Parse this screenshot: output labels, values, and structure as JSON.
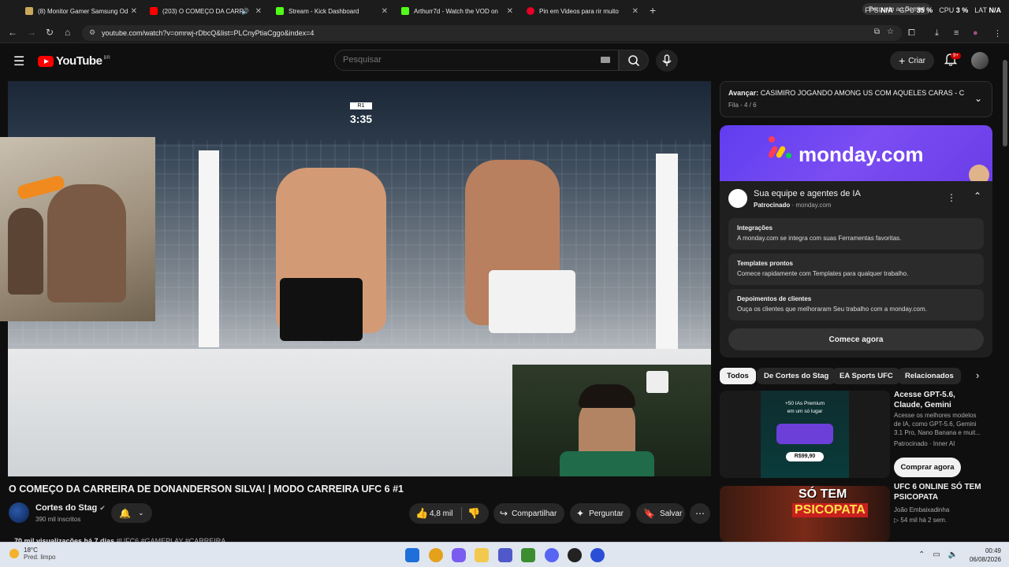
{
  "browser": {
    "tabs": [
      {
        "title": "(8) Monitor Gamer Samsung Od",
        "color": "#c9a85b"
      },
      {
        "title": "(203) O COMEÇO DA CARR",
        "color": "#ff0000"
      },
      {
        "title": "Stream - Kick Dashboard",
        "color": "#53fc18"
      },
      {
        "title": "Arthurr7d - Watch the VOD on",
        "color": "#53fc18"
      },
      {
        "title": "Pin em Videos para rir muito",
        "color": "#e60023"
      }
    ],
    "new_tab": "+",
    "gemini": "Pergunte ao Gemini",
    "perf": {
      "fps_label": "FPS",
      "fps": "N/A",
      "gpu_label": "GPU",
      "gpu": "35 %",
      "cpu_label": "CPU",
      "cpu": "3 %",
      "lat_label": "LAT",
      "lat": "N/A"
    },
    "url": "youtube.com/watch?v=omrwj-rDbcQ&list=PLCnyPtiaCggo&index=4"
  },
  "youtube": {
    "logo": "YouTube",
    "region": "BR",
    "search_placeholder": "Pesquisar",
    "create_label": "Criar",
    "notif_count": "9+"
  },
  "video": {
    "round": "R1",
    "timer": "3:35",
    "title": "O COMEÇO DA CARREIRA DE DONANDERSON SILVA! | MODO CARREIRA UFC 6 #1",
    "channel": "Cortes do Stag",
    "subscribers": "390 mil inscritos",
    "likes": "4,8 mil",
    "share": "Compartilhar",
    "ask": "Perguntar",
    "save": "Salvar",
    "views": "70 mil visualizações  há 7 dias",
    "tags": "#UFC6 #GAMEPLAY #CARREIRA"
  },
  "queue": {
    "label": "Avançar:",
    "next": "CASIMIRO JOGANDO AMONG US COM AQUELES CARAS - C...",
    "position": "Fila - 4 / 6"
  },
  "ad": {
    "brand": "monday.com",
    "title": "Sua equipe e agentes de IA",
    "sponsored": "Patrocinado",
    "domain": "monday.com",
    "features": [
      {
        "h": "Integrações",
        "d": "A monday.com se integra com suas Ferramentas favoritas."
      },
      {
        "h": "Templates prontos",
        "d": "Comece rapidamente com Templates para qualquer trabalho."
      },
      {
        "h": "Depoimentos de clientes",
        "d": "Ouça os clientes que melhoraram Seu trabalho com a monday.com."
      }
    ],
    "cta": "Comece agora"
  },
  "chips": [
    "Todos",
    "De Cortes do Stag",
    "EA Sports UFC",
    "Relacionados"
  ],
  "recs": [
    {
      "title": "Acesse GPT-5.6, Claude, Gemini",
      "desc": "Acesse os melhores modelos de IA, como GPT-5.6, Gemini 3.1 Pro, Nano Banana e muit...",
      "meta": "Patrocinado · Inner AI",
      "cta": "Comprar agora",
      "thumb_top": "+50 IAs Premium",
      "thumb_sub": "em um só lugar",
      "thumb_price": "R$99,90"
    },
    {
      "title": "UFC 6 ONLINE SÓ TEM PSICOPATA",
      "channel": "João Embaixadinha",
      "meta": "54 mil  há 2 sem.",
      "thumb_text": "SÓ TEM PSICOPATA"
    }
  ],
  "taskbar": {
    "temp": "18°C",
    "weather": "Pred. limpo",
    "time": "00:49",
    "date": "06/08/2026"
  }
}
